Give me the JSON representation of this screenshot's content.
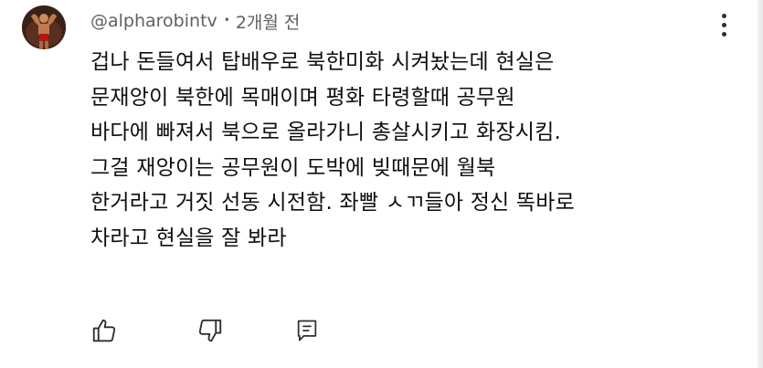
{
  "comment": {
    "author": "@alpharobintv",
    "separator": "•",
    "time": "2개월 전",
    "lines": [
      "겁나 돈들여서 탑배우로 북한미화 시켜놨는데 현실은",
      "문재앙이 북한에 목매이며 평화 타령할때 공무원",
      "바다에 빠져서 북으로 올라가니 총살시키고 화장시킴.",
      "그걸 재앙이는 공무원이 도박에 빚때문에 월북",
      "한거라고 거짓 선동 시전함. 좌빨 ㅅㄲ들아 정신 똑바로",
      "차라고 현실을 잘 봐라"
    ]
  },
  "icons": {
    "avatar": "avatar-bodybuilder",
    "more": "more-vertical-icon",
    "like": "thumbs-up-icon",
    "dislike": "thumbs-down-icon",
    "reply": "reply-comment-icon"
  },
  "colors": {
    "text_primary": "#0f0f0f",
    "text_secondary": "#606060",
    "icon": "#303030",
    "background": "#ffffff"
  }
}
